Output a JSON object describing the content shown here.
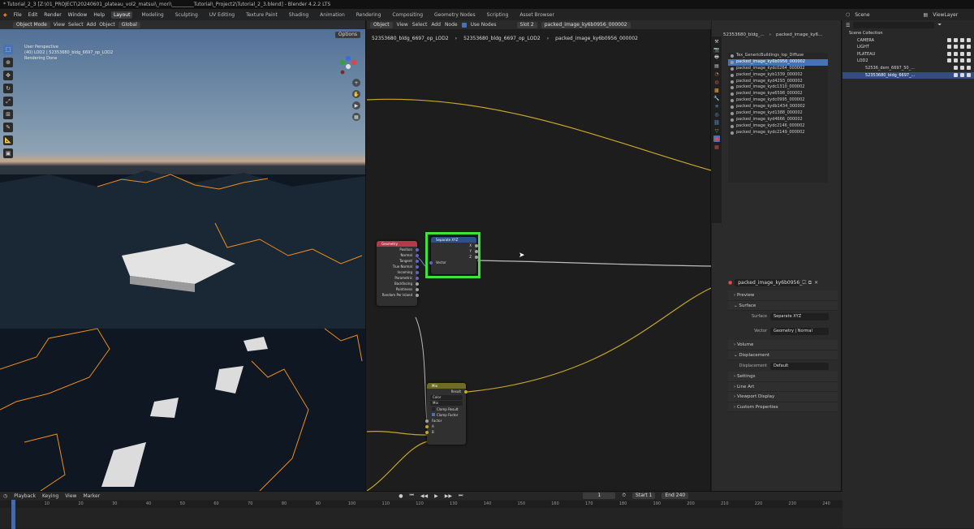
{
  "window": {
    "title": "* Tutorial_2_3 [Z:\\01_PROJECT\\20240601_plateau_vol2_matsui\\_mori\\_________Tutorial\\_Project2\\Tutorial_2_3.blend] - Blender 4.2.2 LTS"
  },
  "menubar": {
    "menus": [
      "File",
      "Edit",
      "Render",
      "Window",
      "Help"
    ],
    "workspaces": [
      "Layout",
      "Modeling",
      "Sculpting",
      "UV Editing",
      "Texture Paint",
      "Shading",
      "Animation",
      "Rendering",
      "Compositing",
      "Geometry Nodes",
      "Scripting",
      "Asset Browser"
    ],
    "active_workspace": "Layout",
    "scene_label": "Scene",
    "viewlayer_label": "ViewLayer"
  },
  "viewport": {
    "mode": "Object Mode",
    "menus": [
      "View",
      "Select",
      "Add",
      "Object"
    ],
    "orientation": "Global",
    "options_label": "Options",
    "overlay_text": {
      "line1": "User Perspective",
      "line2": "(40) LOD2 | 52353680_bldg_6697_op_LOD2",
      "line3": "Rendering Done"
    }
  },
  "node_editor": {
    "object_selector": "Object",
    "menus": [
      "View",
      "Select",
      "Add",
      "Node"
    ],
    "use_nodes_label": "Use Nodes",
    "slot": "Slot 2",
    "material_name": "packed_image_ky6b0956_000002",
    "breadcrumbs": [
      "52353680_bldg_6697_op_LOD2",
      "52353680_bldg_6697_op_LOD2",
      "packed_image_ky6b0956_000002"
    ],
    "geometry_node": {
      "title": "Geometry",
      "outputs": [
        "Position",
        "Normal",
        "Tangent",
        "True Normal",
        "Incoming",
        "Parametric",
        "Backfacing",
        "Pointiness",
        "Random Per Island"
      ]
    },
    "separate_node": {
      "title": "Separate XYZ",
      "outputs": [
        "X",
        "Y",
        "Z"
      ],
      "input": "Vector"
    },
    "mix_node": {
      "title": "Mix",
      "output": "Result",
      "data_type": "Color",
      "blend": "Mix",
      "clamp_result": "Clamp Result",
      "clamp_factor": "Clamp Factor",
      "inputs": [
        "Factor",
        "A",
        "B"
      ]
    }
  },
  "properties": {
    "header_object": "52353680_bldg_...",
    "header_material": "packed_image_ky6...",
    "materials": [
      "Tex_GenericBuildings_lop_Diffuse",
      "packed_image_ky6b0956_000002",
      "packed_image_kydc0264_000002",
      "packed_image_kyb1339_000002",
      "packed_image_kyd4293_000002",
      "packed_image_kydc1310_000002",
      "packed_image_kye6598_000002",
      "packed_image_kydc0995_000002",
      "packed_image_kydb1434_000002",
      "packed_image_kyd1388_000002",
      "packed_image_kyd4666_000002",
      "packed_image_kydc2146_000002",
      "packed_image_kydc2149_000002"
    ],
    "selected_material_index": 1,
    "material_field": "packed_image_ky6b0956_...",
    "sections": {
      "preview": "Preview",
      "surface": "Surface",
      "volume": "Volume",
      "displacement": "Displacement",
      "settings": "Settings",
      "line_art": "Line Art",
      "viewport_display": "Viewport Display",
      "custom_properties": "Custom Properties"
    },
    "surface_label": "Surface",
    "surface_value": "Separate XYZ",
    "vector_label": "Vector",
    "vector_value": "Geometry | Normal",
    "displacement_label": "Displacement",
    "displacement_value": "Default"
  },
  "outliner": {
    "root": "Scene Collection",
    "items": [
      {
        "name": "CAMERA",
        "indent": 1
      },
      {
        "name": "LIGHT",
        "indent": 1
      },
      {
        "name": "PLATEAU",
        "indent": 1
      },
      {
        "name": "LOD2",
        "indent": 1
      },
      {
        "name": "52536_dem_6697_50_...",
        "indent": 2
      },
      {
        "name": "52353680_bldg_6697_...",
        "indent": 2,
        "selected": true
      }
    ]
  },
  "timeline": {
    "menus": [
      "Playback",
      "Keying",
      "View",
      "Marker"
    ],
    "current_frame": "1",
    "start_label": "Start",
    "start": "1",
    "end_label": "End",
    "end": "240",
    "ticks": [
      "0",
      "10",
      "20",
      "30",
      "40",
      "50",
      "60",
      "70",
      "80",
      "90",
      "100",
      "110",
      "120",
      "130",
      "140",
      "150",
      "160",
      "170",
      "180",
      "190",
      "200",
      "210",
      "220",
      "230",
      "240"
    ]
  },
  "colors": {
    "accent": "#4772b3",
    "highlight_box": "#3ee338",
    "wire_yellow": "#c7a52c",
    "selection_orange": "#f08c1c",
    "geometry_header": "#b13a4b",
    "vector_header": "#2d4f8a",
    "mix_header": "#6e6b23"
  }
}
